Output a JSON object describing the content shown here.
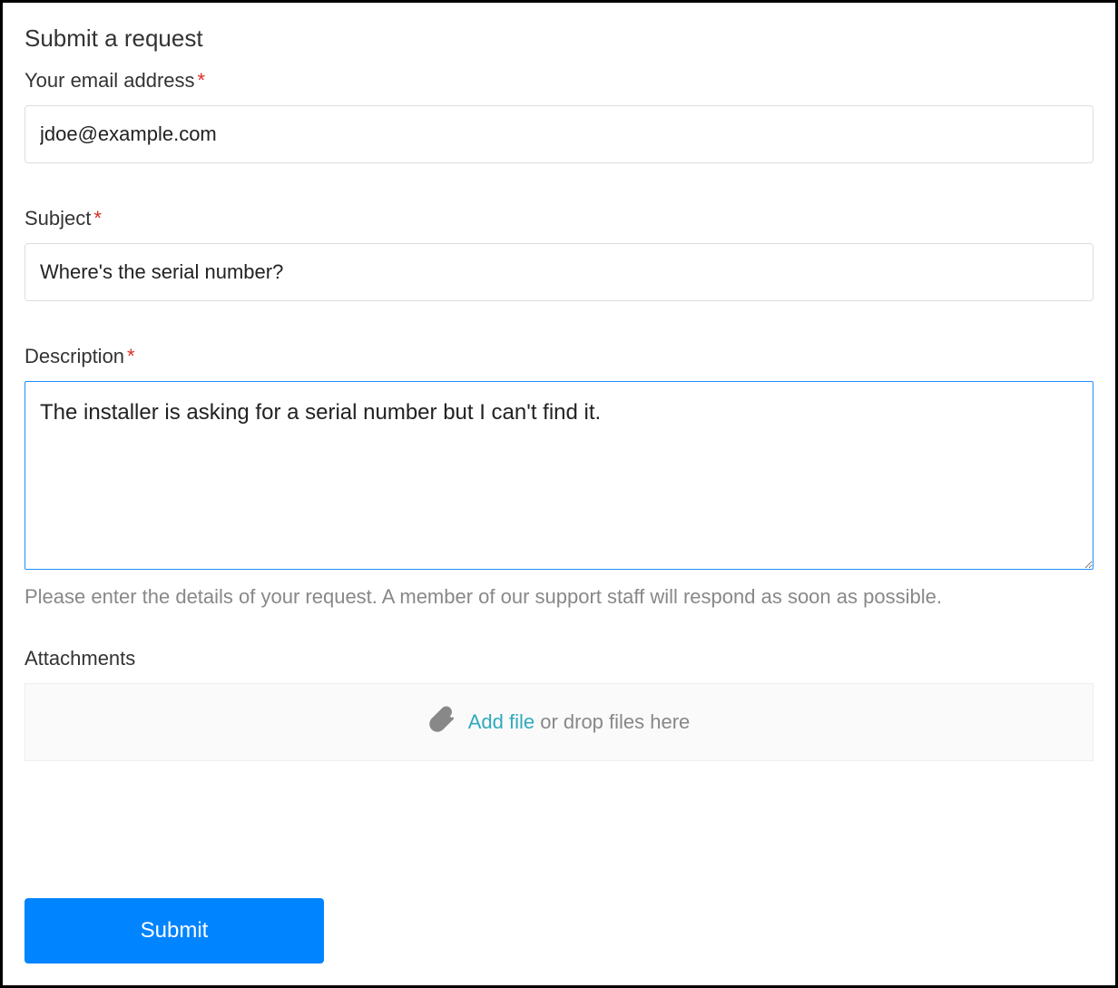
{
  "page": {
    "title": "Submit a request"
  },
  "fields": {
    "email": {
      "label": "Your email address",
      "required": "*",
      "value": "jdoe@example.com"
    },
    "subject": {
      "label": "Subject",
      "required": "*",
      "value": "Where's the serial number?"
    },
    "description": {
      "label": "Description",
      "required": "*",
      "value": "The installer is asking for a serial number but I can't find it.",
      "help_text": "Please enter the details of your request. A member of our support staff will respond as soon as possible."
    },
    "attachments": {
      "label": "Attachments",
      "add_file_text": "Add file",
      "drop_text": " or drop files here"
    }
  },
  "buttons": {
    "submit": "Submit"
  }
}
